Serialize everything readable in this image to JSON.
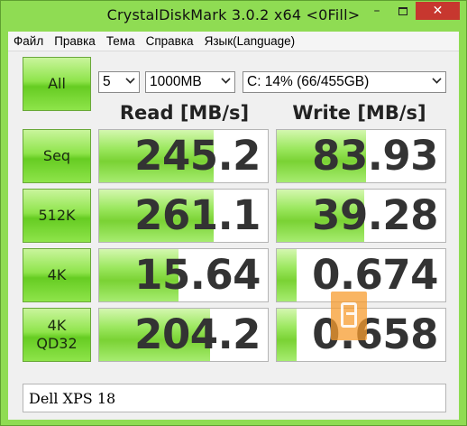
{
  "window": {
    "title": "CrystalDiskMark 3.0.2 x64 <0Fill>",
    "minimize_glyph": "–",
    "close_glyph": "✕"
  },
  "menu": [
    "Файл",
    "Правка",
    "Тема",
    "Справка",
    "Язык(Language)"
  ],
  "controls": {
    "all_label": "All",
    "count_value": "5",
    "size_value": "1000MB",
    "drive_value": "C: 14% (66/455GB)"
  },
  "headers": {
    "read": "Read [MB/s]",
    "write": "Write [MB/s]"
  },
  "tests": [
    {
      "label": "Seq",
      "read": "245.2",
      "write": "83.93",
      "read_fill": 0.68,
      "write_fill": 0.53
    },
    {
      "label": "512K",
      "read": "261.1",
      "write": "39.28",
      "read_fill": 0.68,
      "write_fill": 0.52
    },
    {
      "label": "4K",
      "read": "15.64",
      "write": "0.674",
      "read_fill": 0.47,
      "write_fill": 0.12
    },
    {
      "label": "4K\nQD32",
      "read": "204.2",
      "write": "0.658",
      "read_fill": 0.66,
      "write_fill": 0.12
    }
  ],
  "comment": "Dell XPS 18",
  "colors": {
    "frame": "#8fdc53",
    "button_green": "#66cc22",
    "bar_green": "#7ad234",
    "close_red": "#c7372f",
    "watermark_orange": "#f79c2f"
  }
}
